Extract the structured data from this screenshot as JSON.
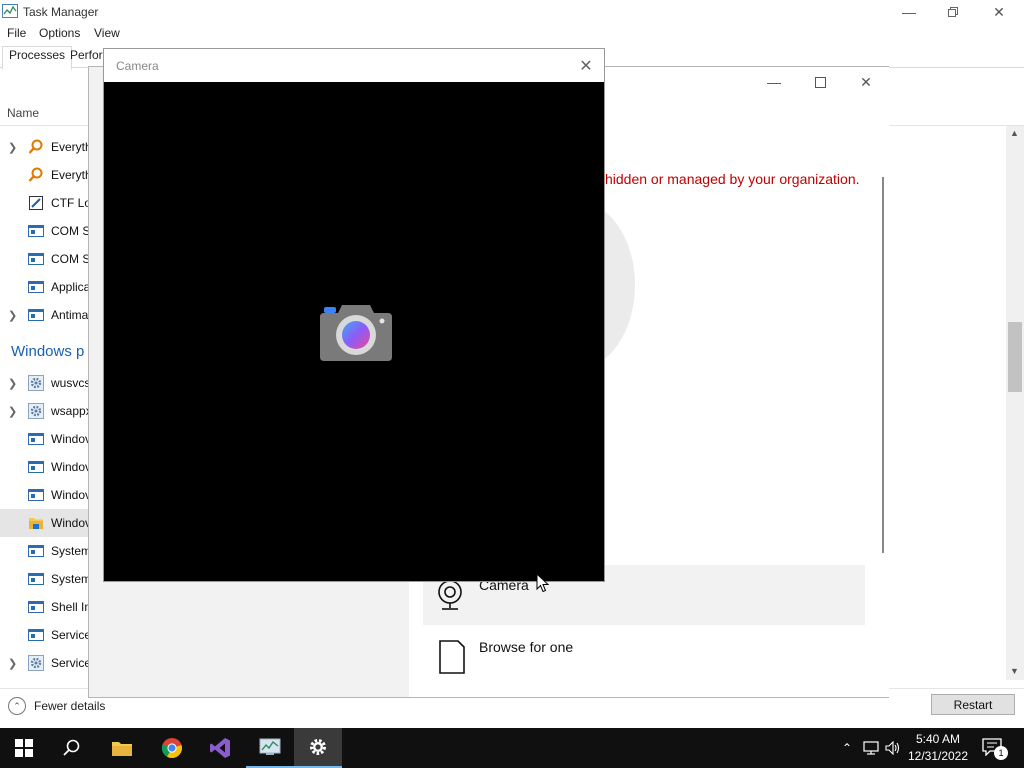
{
  "task_manager": {
    "title": "Task Manager",
    "menu": [
      "File",
      "Options",
      "View"
    ],
    "tabs": [
      "Processes",
      "Perfor"
    ],
    "column_name": "Name",
    "group_windows": "Windows p",
    "rows": [
      {
        "label": "Everyth",
        "expandable": true,
        "icon": "search-app-icon"
      },
      {
        "label": "Everyth",
        "expandable": false,
        "icon": "search-app-icon"
      },
      {
        "label": "CTF Lo",
        "expandable": false,
        "icon": "notepad-icon"
      },
      {
        "label": "COM S",
        "expandable": false,
        "icon": "window-app-icon"
      },
      {
        "label": "COM S",
        "expandable": false,
        "icon": "window-app-icon"
      },
      {
        "label": "Applica",
        "expandable": false,
        "icon": "window-app-icon"
      },
      {
        "label": "Antima",
        "expandable": true,
        "icon": "window-app-icon"
      },
      {
        "label": "wusvcs",
        "expandable": true,
        "icon": "gear-service-icon"
      },
      {
        "label": "wsappx",
        "expandable": true,
        "icon": "gear-service-icon"
      },
      {
        "label": "Windov",
        "expandable": false,
        "icon": "window-app-icon"
      },
      {
        "label": "Windov",
        "expandable": false,
        "icon": "window-app-icon"
      },
      {
        "label": "Windov",
        "expandable": false,
        "icon": "window-app-icon"
      },
      {
        "label": "Windov",
        "expandable": false,
        "icon": "explorer-folder-icon",
        "selected": true
      },
      {
        "label": "System",
        "expandable": false,
        "icon": "window-app-icon"
      },
      {
        "label": "System",
        "expandable": false,
        "icon": "window-app-icon"
      },
      {
        "label": "Shell In",
        "expandable": false,
        "icon": "window-app-icon"
      },
      {
        "label": "Service",
        "expandable": false,
        "icon": "window-app-icon"
      },
      {
        "label": "Service",
        "expandable": true,
        "icon": "gear-service-icon"
      }
    ],
    "fewer_details": "Fewer details",
    "restart_label": "Restart"
  },
  "settings": {
    "notice": "hidden or managed by your organization.",
    "option_camera": "Camera",
    "option_browse": "Browse for one"
  },
  "camera_window": {
    "title": "Camera"
  },
  "taskbar": {
    "apps": [
      "start",
      "search",
      "file-explorer",
      "chrome",
      "visual-studio",
      "task-manager",
      "settings"
    ],
    "time": "5:40 AM",
    "date": "12/31/2022",
    "notifications_count": "1"
  },
  "colors": {
    "accent": "#0078d7",
    "notice_red": "#c00000",
    "taskbar": "#101010",
    "group_blue": "#1a5fb4"
  }
}
